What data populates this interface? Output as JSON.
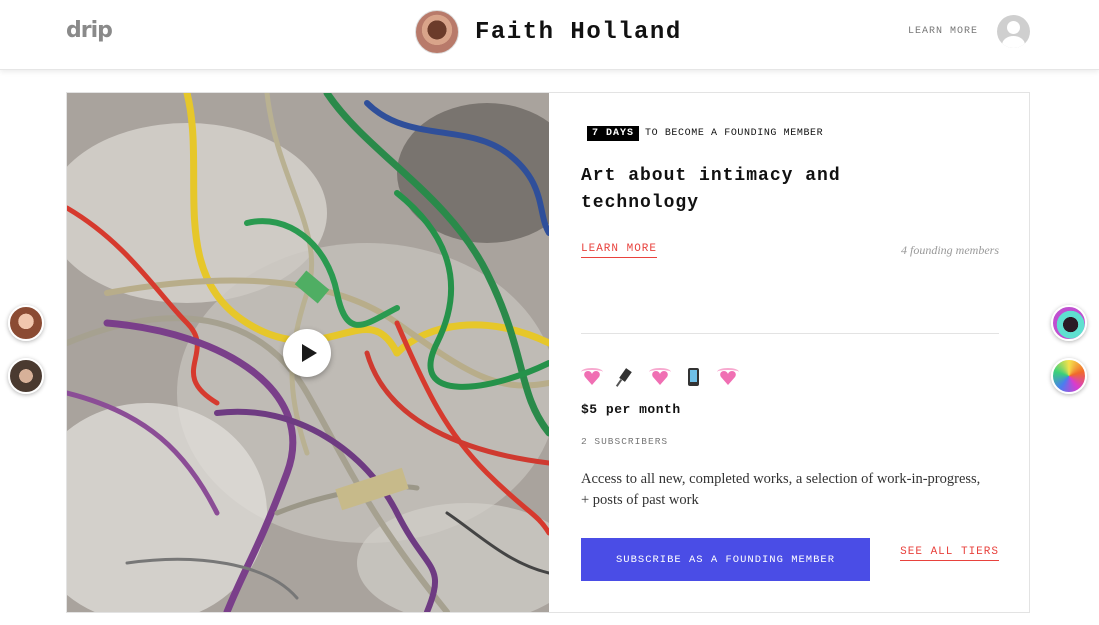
{
  "header": {
    "logo": "drip",
    "creator_name": "Faith Holland",
    "learn_more": "LEARN MORE"
  },
  "campaign": {
    "days_badge": "7 DAYS",
    "countdown_text": "TO BECOME A FOUNDING MEMBER",
    "tagline": "Art about intimacy and technology",
    "learn_more": "LEARN MORE",
    "founding_members": "4 founding members"
  },
  "tier": {
    "emojis": [
      "sparkling-heart",
      "electric-plug",
      "sparkling-heart",
      "mobile-phone",
      "sparkling-heart"
    ],
    "price": "$5 per month",
    "subscribers": "2 SUBSCRIBERS",
    "description": "Access to all new, completed works, a selection of work-in-progress, + posts of past work",
    "subscribe_label": "SUBSCRIBE AS A FOUNDING MEMBER",
    "see_all_tiers": "SEE ALL TIERS"
  },
  "colors": {
    "accent_red": "#e8423d",
    "subscribe_blue": "#4a4de6"
  }
}
